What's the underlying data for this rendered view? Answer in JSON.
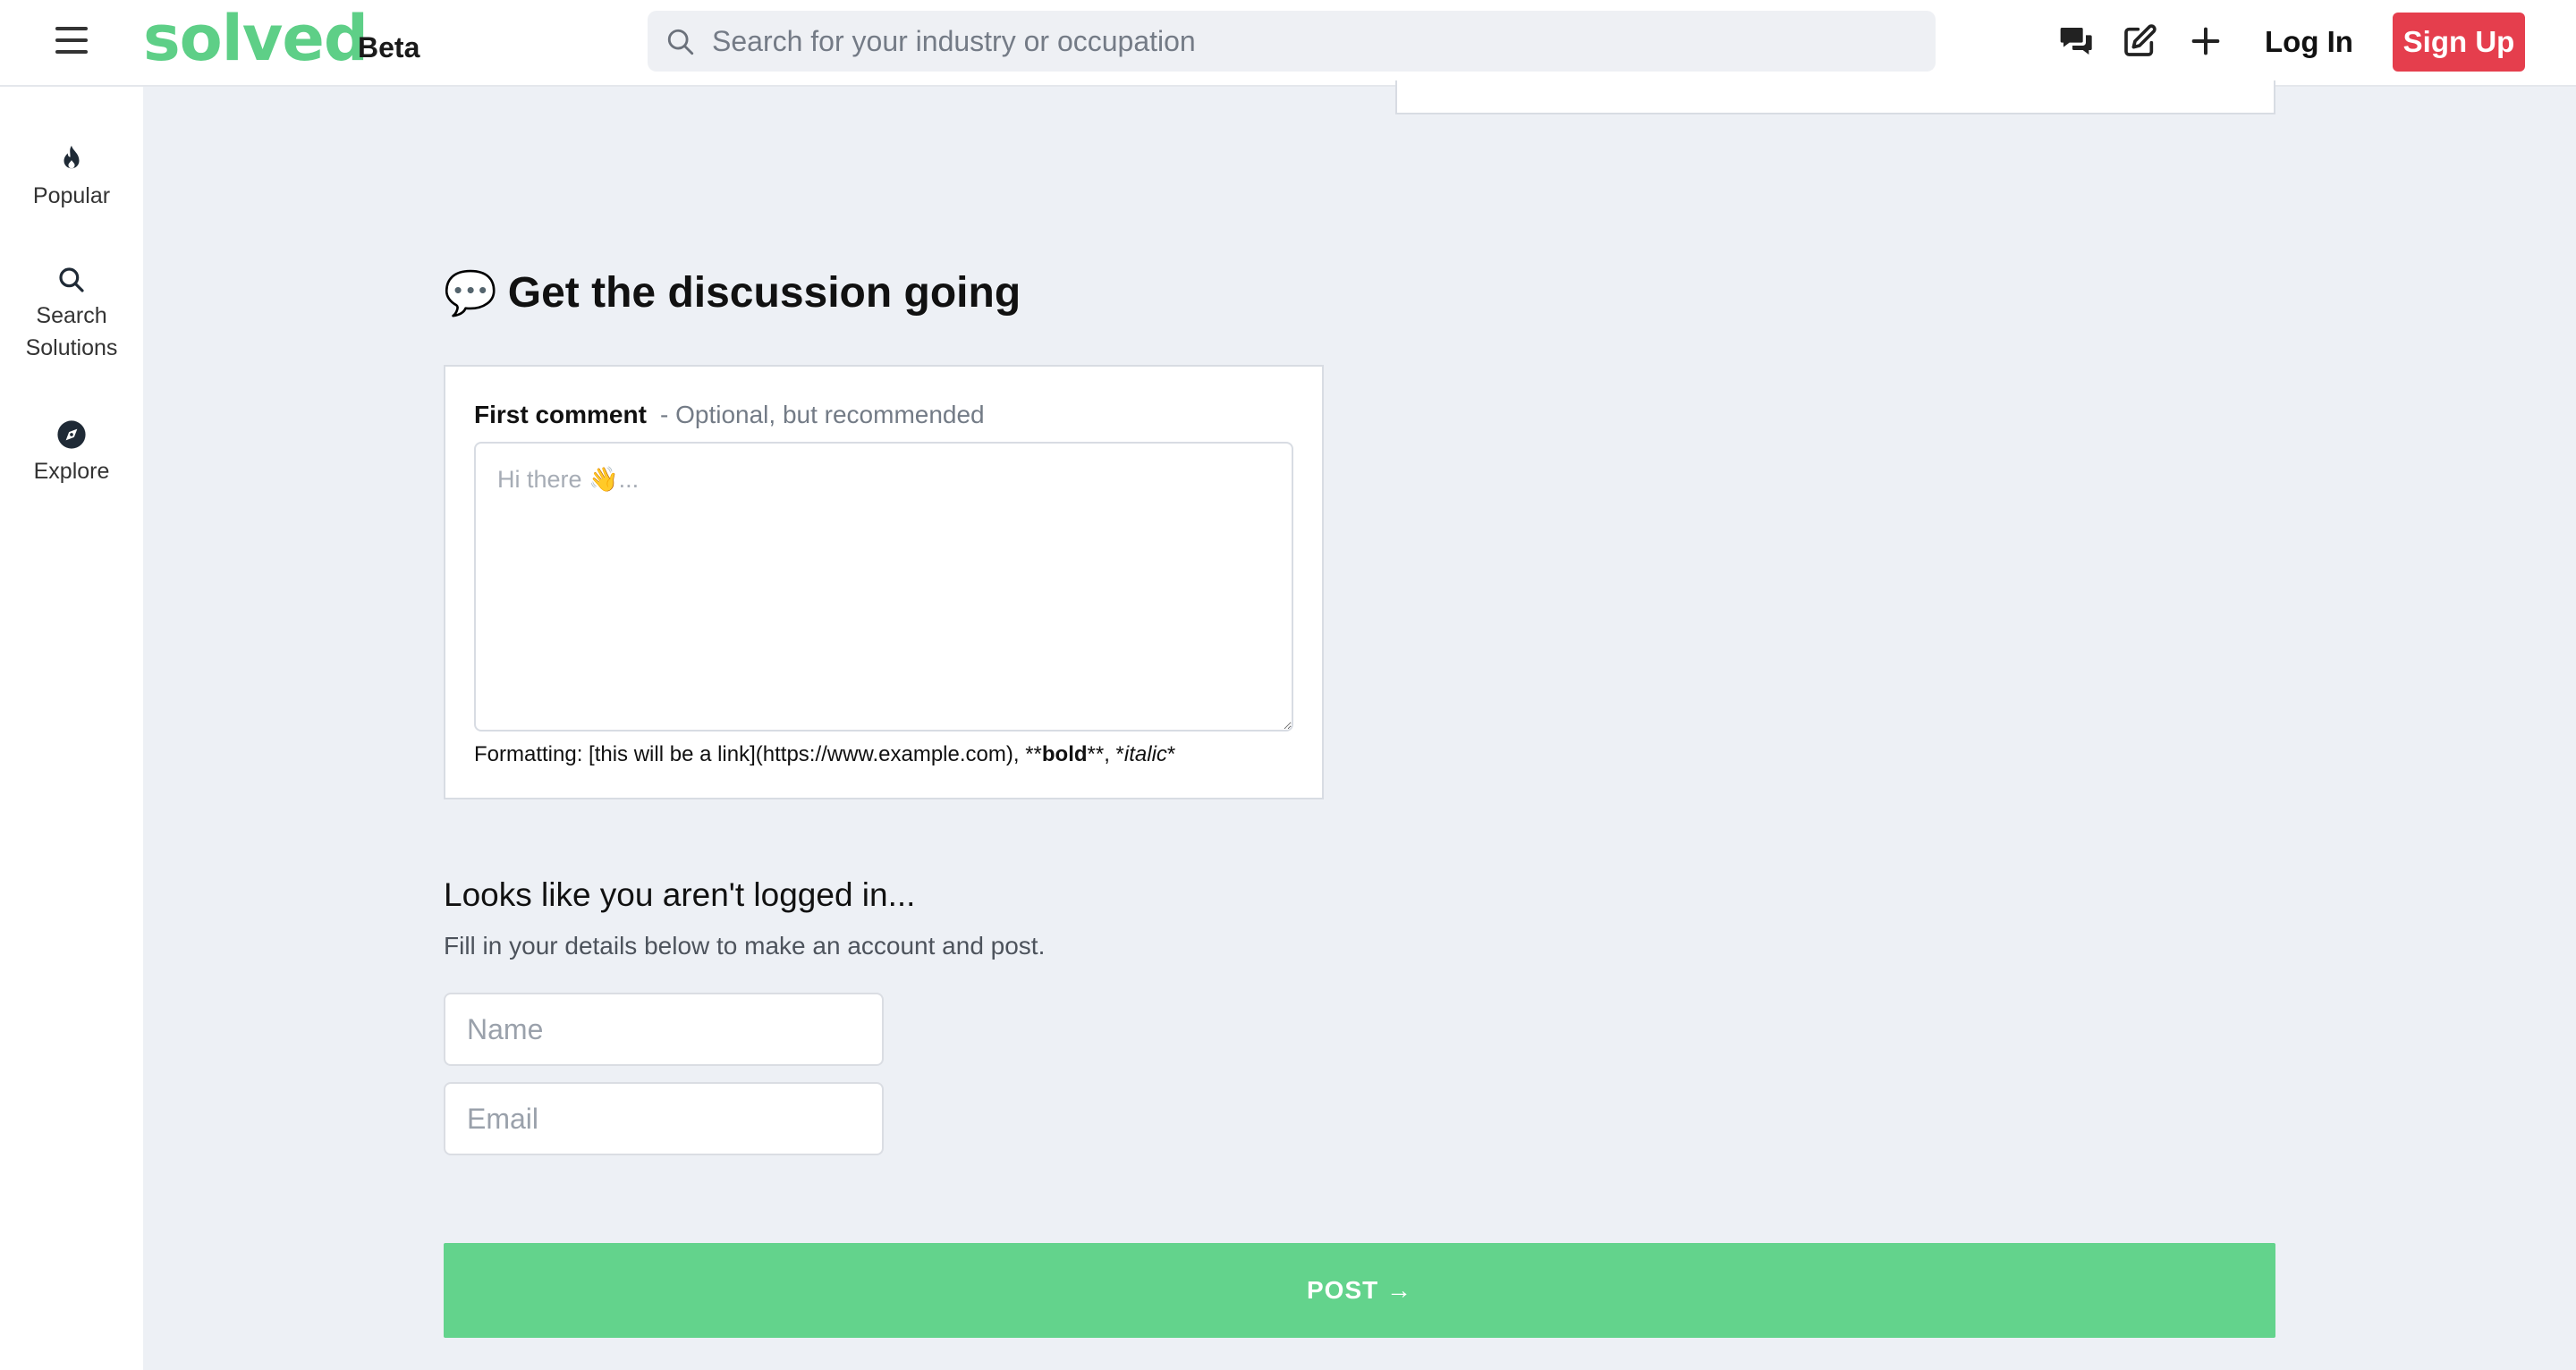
{
  "header": {
    "logo": "solved",
    "beta": "Beta",
    "search_placeholder": "Search for your industry or occupation",
    "login": "Log In",
    "signup": "Sign Up",
    "icons": [
      "menu-icon",
      "chat-bubbles-icon",
      "edit-icon",
      "plus-icon"
    ],
    "brand_color": "#5ecf87",
    "signup_color": "#e53e4d"
  },
  "sidebar": {
    "items": [
      {
        "label": "Popular",
        "icon": "flame-icon"
      },
      {
        "label": "Search",
        "label2": "Solutions",
        "icon": "search-icon"
      },
      {
        "label": "Explore",
        "icon": "compass-icon"
      }
    ]
  },
  "main": {
    "heading_emoji": "💬",
    "heading": "Get the discussion going",
    "comment": {
      "label": "First comment",
      "label_sub": "- Optional, but recommended",
      "placeholder": "Hi there 👋...",
      "format_prefix": "Formatting: [this will be a link](https://www.example.com), **",
      "format_bold": "bold",
      "format_mid": "**, *",
      "format_italic": "italic",
      "format_suffix": "*"
    },
    "login_title": "Looks like you aren't logged in...",
    "login_sub": "Fill in your details below to make an account and post.",
    "name_placeholder": "Name",
    "email_placeholder": "Email",
    "post_button": "POST →",
    "post_color": "#63d38c"
  }
}
